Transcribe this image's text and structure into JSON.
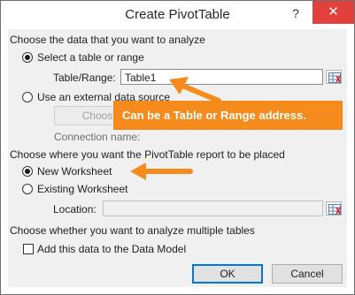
{
  "window": {
    "title": "Create PivotTable",
    "help_label": "?",
    "close_label": "✕"
  },
  "source_section": {
    "heading": "Choose the data that you want to analyze",
    "option_table": {
      "label": "Select a table or range",
      "selected": true
    },
    "table_range": {
      "label": "Table/Range:",
      "value": "Table1"
    },
    "option_external": {
      "label": "Use an external data source",
      "selected": false
    },
    "choose_connection_label": "Choose Con",
    "connection_name_label": "Connection name:"
  },
  "placement_section": {
    "heading": "Choose where you want the PivotTable report to be placed",
    "option_new": {
      "label": "New Worksheet",
      "selected": true
    },
    "option_existing": {
      "label": "Existing Worksheet",
      "selected": false
    },
    "location": {
      "label": "Location:",
      "value": ""
    }
  },
  "multiple_section": {
    "heading": "Choose whether you want to analyze multiple tables",
    "data_model": {
      "label": "Add this data to the Data Model",
      "checked": false
    }
  },
  "buttons": {
    "ok": "OK",
    "cancel": "Cancel"
  },
  "annotations": {
    "callout_text": "Can be a Table or Range address."
  },
  "colors": {
    "accent": "#0078d7",
    "callout": "#f58b1c",
    "close": "#e2403a"
  }
}
